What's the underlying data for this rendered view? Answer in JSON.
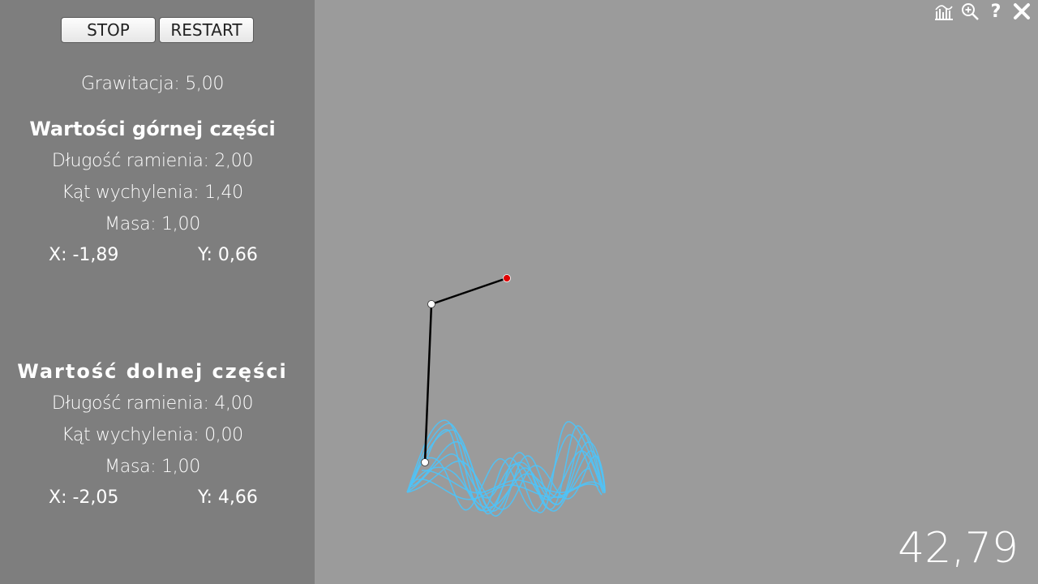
{
  "controls": {
    "stop_label": "STOP",
    "restart_label": "RESTART"
  },
  "gravity": "Grawitacja: 5,00",
  "upper": {
    "heading": "Wartości górnej części",
    "length": "Długość ramienia: 2,00",
    "angle": "Kąt wychylenia: 1,40",
    "mass": "Masa: 1,00",
    "x": "X: -1,89",
    "y": "Y: 0,66"
  },
  "lower": {
    "heading": "Wartość dolnej części",
    "length": "Długość ramienia: 4,00",
    "angle": "Kąt wychylenia: 0,00",
    "mass": "Masa: 1,00",
    "x": "X: -2,05",
    "y": "Y: 4,66"
  },
  "timer": "42,79",
  "icons": [
    "chart-icon",
    "zoom-icon",
    "help-icon",
    "close-icon"
  ],
  "colors": {
    "sidebar_bg": "#7e7e7e",
    "canvas_bg": "#9b9b9b",
    "trace": "#4fc3f7",
    "pivot": "#e00000",
    "arm": "#000000"
  }
}
